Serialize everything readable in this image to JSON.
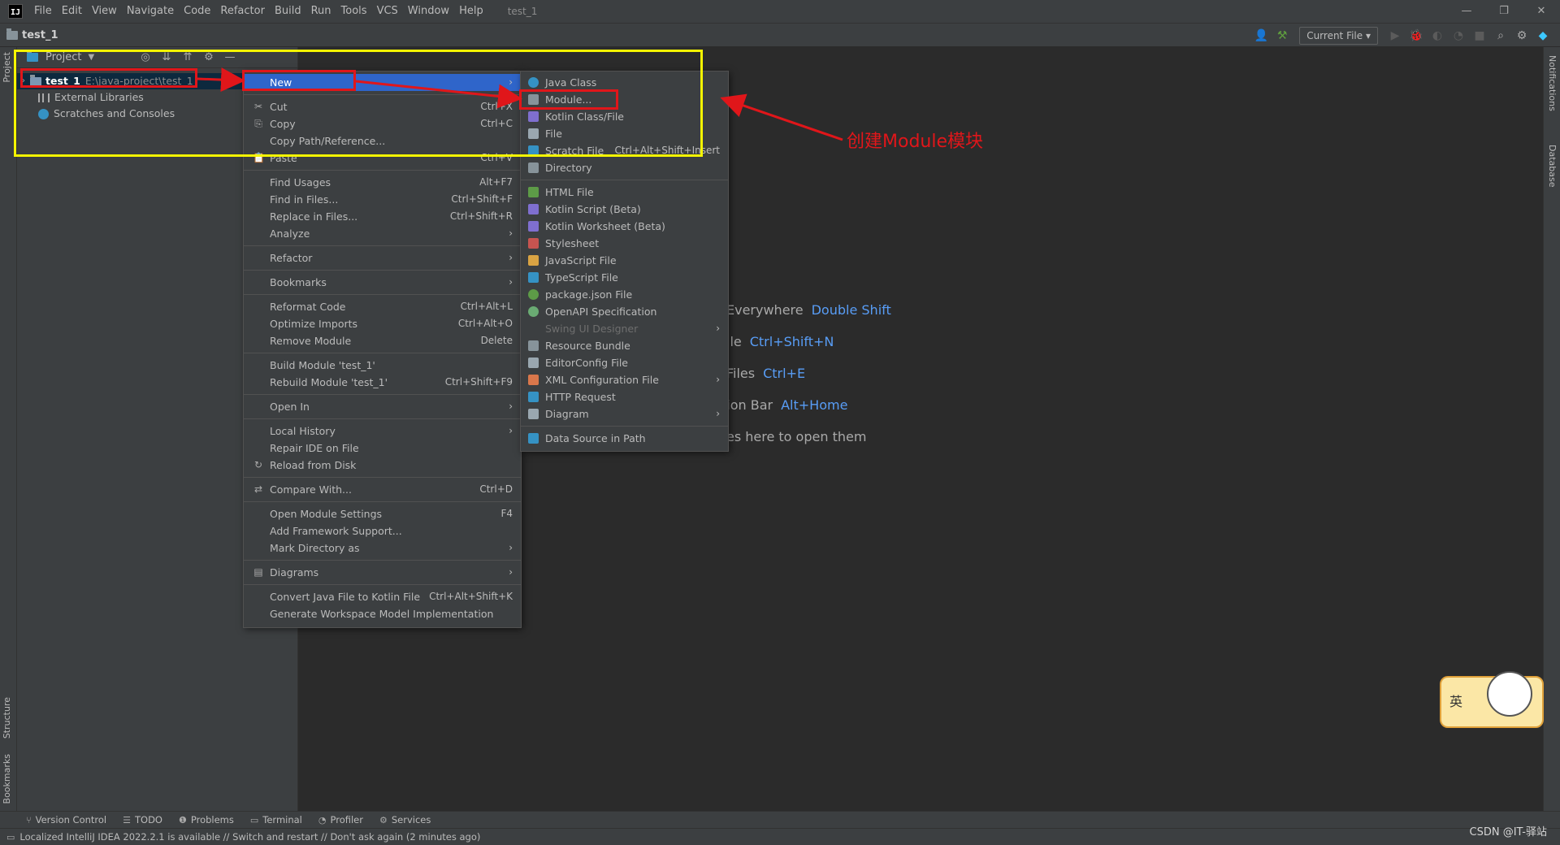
{
  "window": {
    "title": "test_1",
    "controls": [
      "—",
      "❐",
      "✕"
    ]
  },
  "menubar": [
    "File",
    "Edit",
    "View",
    "Navigate",
    "Code",
    "Refactor",
    "Build",
    "Run",
    "Tools",
    "VCS",
    "Window",
    "Help"
  ],
  "navbar": {
    "project": "test_1",
    "run_config": "Current File"
  },
  "left_stripe": {
    "top": "Project",
    "structure": "Structure",
    "bookmarks": "Bookmarks"
  },
  "right_stripe": {
    "notifications": "Notifications",
    "database": "Database"
  },
  "project_panel": {
    "title": "Project",
    "tree": [
      {
        "name": "test_1",
        "path": "E:\\java-project\\test_1",
        "selected": true
      },
      {
        "name": "External Libraries"
      },
      {
        "name": "Scratches and Consoles"
      }
    ]
  },
  "context_menu": [
    {
      "label": "New",
      "arrow": "›",
      "active": true
    },
    {
      "sep": true
    },
    {
      "label": "Cut",
      "shortcut": "Ctrl+X",
      "icon": "✂"
    },
    {
      "label": "Copy",
      "shortcut": "Ctrl+C",
      "icon": "⎘"
    },
    {
      "label": "Copy Path/Reference..."
    },
    {
      "label": "Paste",
      "shortcut": "Ctrl+V",
      "icon": "📋"
    },
    {
      "sep": true
    },
    {
      "label": "Find Usages",
      "shortcut": "Alt+F7"
    },
    {
      "label": "Find in Files...",
      "shortcut": "Ctrl+Shift+F"
    },
    {
      "label": "Replace in Files...",
      "shortcut": "Ctrl+Shift+R"
    },
    {
      "label": "Analyze",
      "arrow": "›"
    },
    {
      "sep": true
    },
    {
      "label": "Refactor",
      "arrow": "›"
    },
    {
      "sep": true
    },
    {
      "label": "Bookmarks",
      "arrow": "›"
    },
    {
      "sep": true
    },
    {
      "label": "Reformat Code",
      "shortcut": "Ctrl+Alt+L"
    },
    {
      "label": "Optimize Imports",
      "shortcut": "Ctrl+Alt+O"
    },
    {
      "label": "Remove Module",
      "shortcut": "Delete"
    },
    {
      "sep": true
    },
    {
      "label": "Build Module 'test_1'"
    },
    {
      "label": "Rebuild Module 'test_1'",
      "shortcut": "Ctrl+Shift+F9"
    },
    {
      "sep": true
    },
    {
      "label": "Open In",
      "arrow": "›"
    },
    {
      "sep": true
    },
    {
      "label": "Local History",
      "arrow": "›"
    },
    {
      "label": "Repair IDE on File"
    },
    {
      "label": "Reload from Disk",
      "icon": "↻"
    },
    {
      "sep": true
    },
    {
      "label": "Compare With...",
      "shortcut": "Ctrl+D",
      "icon": "⇄"
    },
    {
      "sep": true
    },
    {
      "label": "Open Module Settings",
      "shortcut": "F4"
    },
    {
      "label": "Add Framework Support..."
    },
    {
      "label": "Mark Directory as",
      "arrow": "›"
    },
    {
      "sep": true
    },
    {
      "label": "Diagrams",
      "arrow": "›",
      "icon": "▤"
    },
    {
      "sep": true
    },
    {
      "label": "Convert Java File to Kotlin File",
      "shortcut": "Ctrl+Alt+Shift+K"
    },
    {
      "label": "Generate Workspace Model Implementation"
    }
  ],
  "new_submenu": [
    {
      "label": "Java Class",
      "color": "#3592c4",
      "round": true
    },
    {
      "label": "Module...",
      "color": "#87939a"
    },
    {
      "label": "Kotlin Class/File",
      "color": "#7f6fcf"
    },
    {
      "label": "File",
      "color": "#9aa7b0"
    },
    {
      "label": "Scratch File",
      "shortcut": "Ctrl+Alt+Shift+Insert",
      "color": "#3592c4"
    },
    {
      "label": "Directory",
      "color": "#87939a"
    },
    {
      "sep": true
    },
    {
      "label": "HTML File",
      "color": "#5d9b47"
    },
    {
      "label": "Kotlin Script (Beta)",
      "color": "#7f6fcf"
    },
    {
      "label": "Kotlin Worksheet (Beta)",
      "color": "#7f6fcf"
    },
    {
      "label": "Stylesheet",
      "color": "#c75450"
    },
    {
      "label": "JavaScript File",
      "color": "#d9a343"
    },
    {
      "label": "TypeScript File",
      "color": "#3592c4"
    },
    {
      "label": "package.json File",
      "color": "#5d9b47",
      "round": true
    },
    {
      "label": "OpenAPI Specification",
      "color": "#6aab73",
      "round": true
    },
    {
      "label": "Swing UI Designer",
      "arrow": "›",
      "disabled": true
    },
    {
      "label": "Resource Bundle",
      "color": "#87939a"
    },
    {
      "label": "EditorConfig File",
      "color": "#9aa7b0"
    },
    {
      "label": "XML Configuration File",
      "arrow": "›",
      "color": "#d9774b"
    },
    {
      "label": "HTTP Request",
      "color": "#3592c4"
    },
    {
      "label": "Diagram",
      "arrow": "›",
      "color": "#9aa7b0"
    },
    {
      "sep": true
    },
    {
      "label": "Data Source in Path",
      "color": "#3592c4"
    }
  ],
  "editor_hints": [
    {
      "text": "Everywhere",
      "key": "Double Shift"
    },
    {
      "text": "ile",
      "key": "Ctrl+Shift+N"
    },
    {
      "text": "Files",
      "key": "Ctrl+E"
    },
    {
      "text": "tion Bar",
      "key": "Alt+Home"
    },
    {
      "text": "es here to open them",
      "key": ""
    }
  ],
  "annotation": {
    "text": "创建Module模块"
  },
  "sticker": {
    "char": "英"
  },
  "tool_windows": [
    {
      "label": "Version Control",
      "icon": "⑂"
    },
    {
      "label": "TODO",
      "icon": "☰"
    },
    {
      "label": "Problems",
      "icon": "❶"
    },
    {
      "label": "Terminal",
      "icon": "▭"
    },
    {
      "label": "Profiler",
      "icon": "◔"
    },
    {
      "label": "Services",
      "icon": "⚙"
    }
  ],
  "status": {
    "text": "Localized IntelliJ IDEA 2022.2.1 is available // Switch and restart // Don't ask again (2 minutes ago)",
    "watermark": "CSDN @IT-驿站"
  }
}
